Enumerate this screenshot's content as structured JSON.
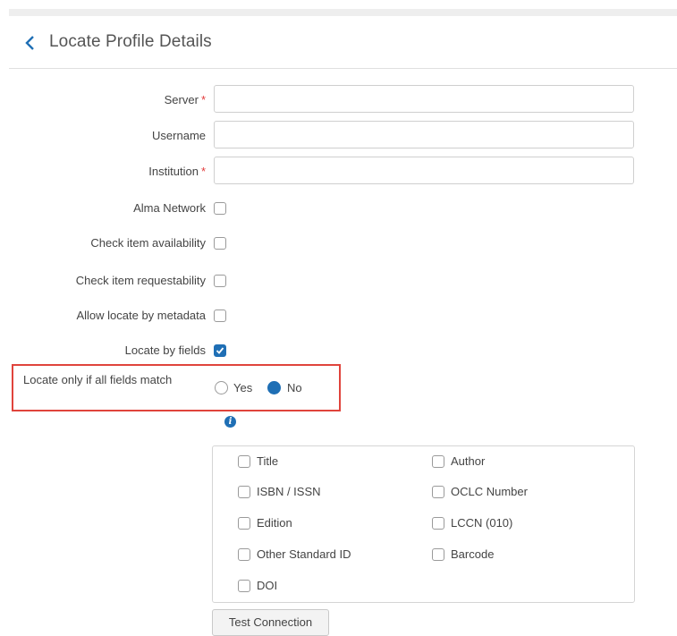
{
  "header": {
    "title": "Locate Profile Details",
    "back_icon": "chevron-left-icon"
  },
  "form": {
    "server_label": "Server",
    "username_label": "Username",
    "institution_label": "Institution",
    "required_mark": "*",
    "alma_network_label": "Alma Network",
    "check_availability_label": "Check item availability",
    "check_requestability_label": "Check item requestability",
    "allow_metadata_label": "Allow locate by metadata",
    "locate_by_fields_label": "Locate by fields",
    "locate_by_fields_checked": true,
    "match_all_label": "Locate only if all fields match",
    "match_all_options": [
      "Yes",
      "No"
    ],
    "match_all_selected": "No"
  },
  "fields": {
    "left": [
      "Title",
      "ISBN / ISSN",
      "Edition",
      "Other Standard ID",
      "DOI"
    ],
    "right": [
      "Author",
      "OCLC Number",
      "LCCN (010)",
      "Barcode"
    ]
  },
  "actions": {
    "test_connection_label": "Test Connection"
  },
  "colors": {
    "accent": "#1f6fb5",
    "highlight": "#e0443c",
    "required": "#e23b3b"
  }
}
